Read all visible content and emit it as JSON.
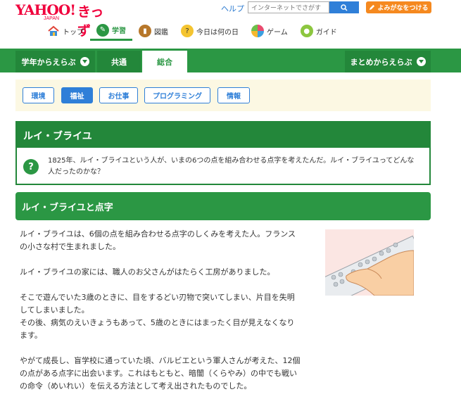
{
  "header": {
    "logo_main": "YAHOO!",
    "logo_sub": "JAPAN",
    "logo_kids": "きっず",
    "help": "ヘルプ",
    "search_placeholder": "インターネットでさがす",
    "yomigana_button": "よみがなをつける"
  },
  "gnav": [
    {
      "label": "トップ",
      "icon": "home-icon"
    },
    {
      "label": "学習",
      "icon": "pencil-icon"
    },
    {
      "label": "図鑑",
      "icon": "book-icon"
    },
    {
      "label": "今日は何の日",
      "icon": "calendar-icon"
    },
    {
      "label": "ゲーム",
      "icon": "game-icon"
    },
    {
      "label": "ガイド",
      "icon": "guide-icon"
    }
  ],
  "tabs": {
    "grade": "学年からえらぶ",
    "common": "共通",
    "general": "総合",
    "summary": "まとめからえらぶ"
  },
  "chips": [
    "環境",
    "福祉",
    "お仕事",
    "プログラミング",
    "情報"
  ],
  "topic": {
    "title": "ルイ・ブライユ",
    "question_mark": "?",
    "description": "1825年、ルイ・ブライユという人が、いまの6つの点を組み合わせる点字を考えたんだ。ルイ・ブライユってどんな人だったのかな？"
  },
  "section": {
    "heading": "ルイ・ブライユと点字"
  },
  "article": {
    "p1": "ルイ・ブライユは、6個の点を組み合わせる点字のしくみを考えた人。フランスの小さな村で生まれました。",
    "p2": "ルイ・ブライユの家には、職人のお父さんがはたらく工房がありました。",
    "p3a": "そこで遊んでいた3歳のときに、目をするどい刃物で突いてしまい、片目を失明してしまいました。",
    "p3b": "その後、病気のえいきょうもあって、5歳のときにはまったく目が見えなくなります。",
    "p4": "やがて成長し、盲学校に通っていた頃、バルビエという軍人さんが考えた、12個の点がある点字に出会います。これはもともと、暗闇（くらやみ）の中でも戦いの命令（めいれい）を伝える方法として考え出されたものでした。"
  },
  "colors": {
    "green": "#2b9744",
    "dark_green": "#23873a",
    "blue": "#2f7fd8",
    "orange": "#f5891f",
    "cream": "#fcf8e3"
  }
}
